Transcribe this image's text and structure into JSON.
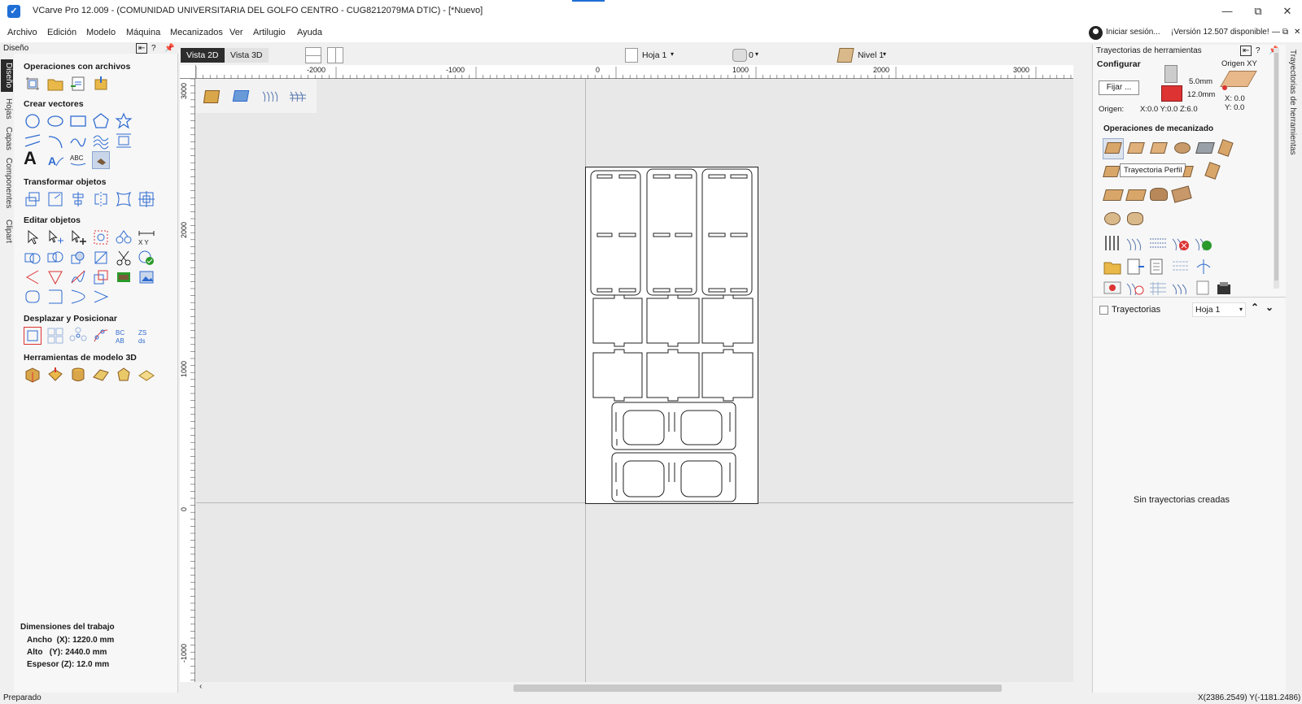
{
  "window": {
    "title": "VCarve Pro 12.009 - (COMUNIDAD UNIVERSITARIA DEL GOLFO CENTRO - CUG8212079MA DTIC) - [*Nuevo]",
    "controls": [
      "—",
      "⧉",
      "✕"
    ]
  },
  "menu": {
    "items": [
      "Archivo",
      "Edición",
      "Modelo",
      "Máquina",
      "Mecanizados",
      "Ver",
      "Artilugio",
      "Ayuda"
    ],
    "signin": "Iniciar sesión...",
    "update": "¡Versión 12.507 disponible!",
    "right_controls": [
      "—",
      "⧉",
      "✕"
    ]
  },
  "left_panel": {
    "header": "Diseño",
    "vertical_tabs": [
      "Diseño",
      "Hojas",
      "Capas",
      "Componentes",
      "Clipart"
    ],
    "sections": {
      "file_ops": "Operaciones con archivos",
      "create_vectors": "Crear vectores",
      "transform": "Transformar objetos",
      "edit": "Editar objetos",
      "move": "Desplazar y Posicionar",
      "model3d": "Herramientas de modelo 3D"
    },
    "job": {
      "title": "Dimensiones del trabajo",
      "width": "Ancho  (X): 1220.0 mm",
      "height": "Alto   (Y): 2440.0 mm",
      "thickness": "Espesor (Z): 12.0 mm"
    }
  },
  "view": {
    "tab_2d": "Vista 2D",
    "tab_3d": "Vista 3D",
    "sheet": "Hoja 1",
    "count": "0",
    "level": "Nivel 1"
  },
  "rulers": {
    "top": [
      "-2000",
      "-1000",
      "0",
      "1000",
      "2000",
      "3000"
    ],
    "left": [
      "3000",
      "2000",
      "1000",
      "0",
      "-1000"
    ]
  },
  "right_panel": {
    "header": "Trayectorias de herramientas",
    "configure": "Configurar",
    "origin_xy": "Origen XY",
    "set_button": "Fijar ...",
    "depth1": "5.0mm",
    "depth2": "12.0mm",
    "x_val": "X: 0.0",
    "y_val": "Y: 0.0",
    "origin_label": "Origen:",
    "origin_value": "X:0.0 Y:0.0 Z:6.0",
    "machining_ops": "Operaciones de mecanizado",
    "tooltip": "Trayectoria Perfil",
    "toolpaths": "Trayectorias",
    "toolpath_sheet": "Hoja 1",
    "empty": "Sin trayectorias creadas",
    "vertical_tab": "Trayectorias de herramientas"
  },
  "status": {
    "left": "Preparado",
    "coords": "X(2386.2549) Y(-1181.2486)"
  },
  "colors": {
    "accent": "#1f6fd6",
    "link": "#1a73d6",
    "icon_blue": "#2f6bd1",
    "canvas_bg": "#e8e8e8"
  }
}
